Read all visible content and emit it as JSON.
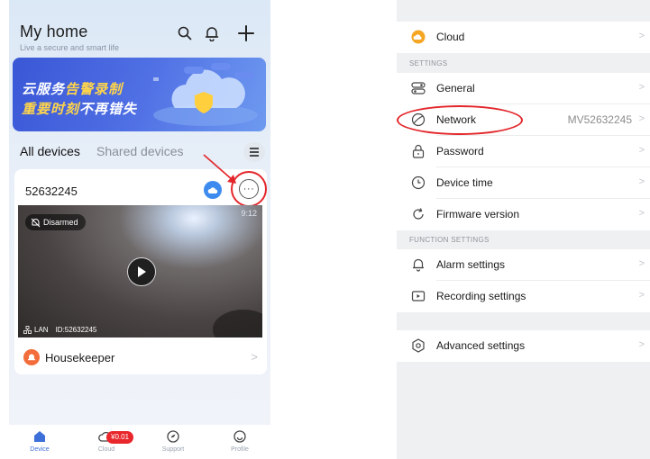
{
  "left": {
    "title": "My home",
    "subtitle": "Live a secure and smart life",
    "banner": {
      "line1_prefix": "云服务",
      "line1_highlight": "告警录制",
      "line2_highlight": "重要时刻",
      "line2_suffix": "不再错失"
    },
    "tabs": {
      "all": "All devices",
      "shared": "Shared devices"
    },
    "device": {
      "name": "52632245",
      "status": "Disarmed",
      "timestamp": "9:12",
      "network_tag": "LAN",
      "id_label": "ID:52632245"
    },
    "housekeeper": {
      "label": "Housekeeper",
      "chevron": ">"
    },
    "nav": {
      "device": "Device",
      "cloud": "Cloud",
      "support": "Support",
      "profile": "Profile",
      "promo_badge": "¥0.01"
    }
  },
  "right": {
    "cloud": {
      "label": "Cloud"
    },
    "section_settings": "SETTINGS",
    "general": "General",
    "network": {
      "label": "Network",
      "value": "MV52632245"
    },
    "password": "Password",
    "device_time": "Device time",
    "firmware_version": "Firmware version",
    "section_function": "FUNCTION SETTINGS",
    "alarm_settings": "Alarm settings",
    "recording_settings": "Recording settings",
    "advanced_settings": "Advanced settings",
    "chevron": ">"
  },
  "colors": {
    "accent_blue": "#3d6fd8",
    "highlight_red": "#e3262b",
    "banner_yellow": "#ffd54a",
    "housekeeper_orange": "#f36d3c"
  }
}
